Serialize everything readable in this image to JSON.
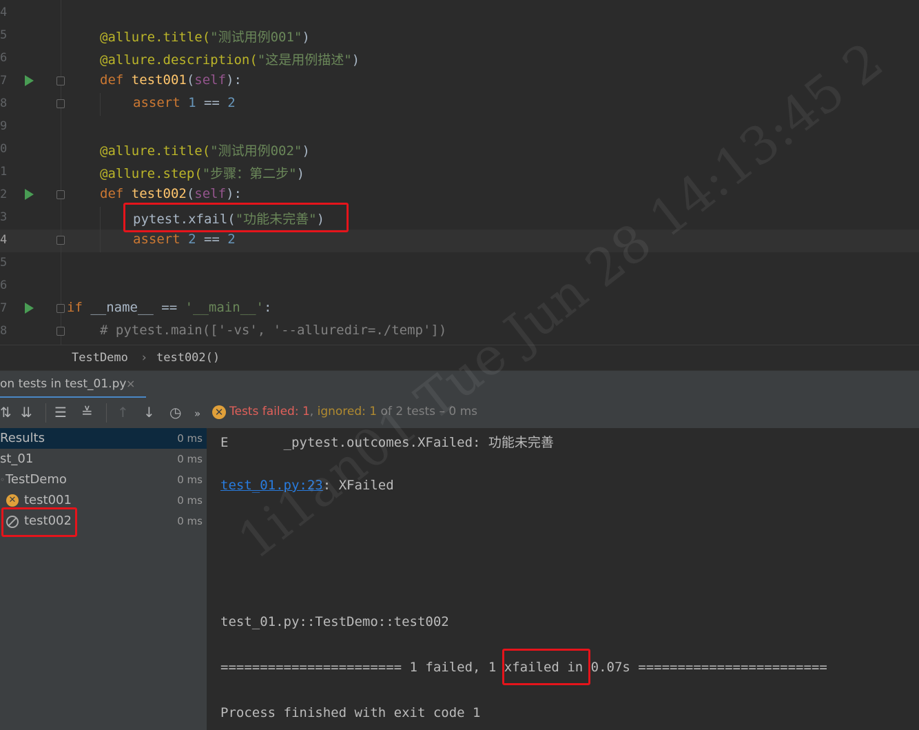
{
  "editor": {
    "line_numbers": [
      "4",
      "5",
      "6",
      "7",
      "8",
      "9",
      "0",
      "1",
      "2",
      "3",
      "4",
      "5",
      "6",
      "7",
      "8"
    ],
    "lines": {
      "l5_dec": "@allure.title(",
      "l5_str": "\"测试用例001\"",
      "l5_end": ")",
      "l6_dec": "@allure.description(",
      "l6_str": "\"这是用例描述\"",
      "l6_end": ")",
      "l7_kw": "def ",
      "l7_fn": "test001",
      "l7_p1": "(",
      "l7_self": "self",
      "l7_p2": "):",
      "l8_kw": "assert ",
      "l8_n1": "1",
      "l8_op": " == ",
      "l8_n2": "2",
      "l10_dec": "@allure.title(",
      "l10_str": "\"测试用例002\"",
      "l10_end": ")",
      "l11_dec": "@allure.step(",
      "l11_str": "\"步骤：第二步\"",
      "l11_end": ")",
      "l12_kw": "def ",
      "l12_fn": "test002",
      "l12_p1": "(",
      "l12_self": "self",
      "l12_p2": "):",
      "l13_code": "pytest.xfail(",
      "l13_str": "\"功能未完善\"",
      "l13_end": ")",
      "l14_kw": "assert ",
      "l14_n1": "2",
      "l14_op": " == ",
      "l14_n2": "2",
      "l17_kw": "if",
      "l17_code": " __name__ == ",
      "l17_str": "'__main__'",
      "l17_end": ":",
      "l18_cmt": "# pytest.main(['-vs', '--alluredir=./temp'])"
    }
  },
  "breadcrumb": {
    "class_name": "TestDemo",
    "separator": "›",
    "method": "test002()"
  },
  "run_tab": {
    "title": "on tests in test_01.py",
    "close": "×"
  },
  "toolbar": {
    "icons": [
      "sort-alpha-icon",
      "sort-duration-icon",
      "expand-all-icon",
      "collapse-all-icon",
      "previous-failed-icon",
      "next-failed-icon",
      "history-icon",
      "more-icon"
    ],
    "status_failed": "Tests failed: 1",
    "status_comma1": ", ",
    "status_ignored": "ignored: 1",
    "status_rest": " of 2 tests – 0 ms"
  },
  "tree": {
    "rows": [
      {
        "label": "Results",
        "time": "0 ms"
      },
      {
        "label": "st_01",
        "time": "0 ms"
      },
      {
        "label": "TestDemo",
        "time": "0 ms"
      },
      {
        "label": "test001",
        "time": "0 ms"
      },
      {
        "label": "test002",
        "time": "0 ms"
      }
    ]
  },
  "console": {
    "line1": "E       _pytest.outcomes.XFailed: 功能未完善",
    "line2_link": "test_01.py:23",
    "line2_rest": ": XFailed",
    "line3": "test_01.py::TestDemo::test002",
    "line4": "======================= 1 failed, 1 xfailed in 0.07s ========================",
    "line5": "Process finished with exit code 1"
  },
  "watermark": "1i1an01 Tue Jun 28 14:13:45 2",
  "colors": {
    "keyword": "#cc7832",
    "decorator": "#bbb529",
    "string": "#6a8759",
    "number": "#6897bb",
    "highlight": "#e5141b"
  }
}
